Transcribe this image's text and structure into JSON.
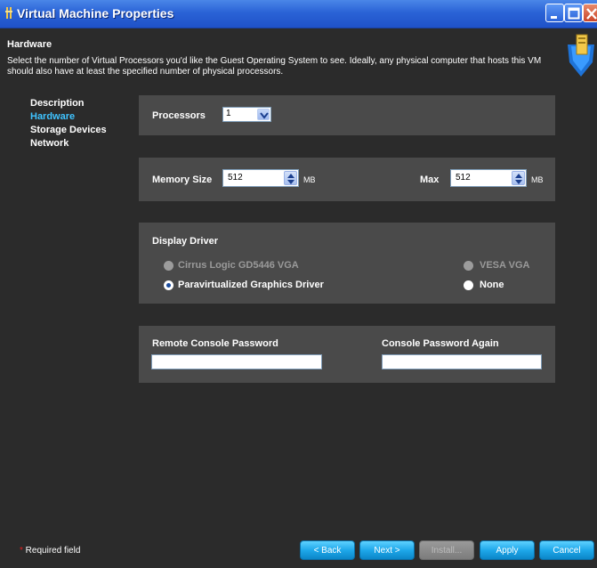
{
  "window": {
    "title": "Virtual Machine Properties"
  },
  "header": {
    "title": "Hardware",
    "description": "Select the number of Virtual Processors you'd like the Guest Operating System to see. Ideally, any physical computer that hosts this VM should also have at least the specified number of physical processors."
  },
  "nav": {
    "items": [
      {
        "label": "Description",
        "active": false
      },
      {
        "label": "Hardware",
        "active": true
      },
      {
        "label": "Storage Devices",
        "active": false
      },
      {
        "label": "Network",
        "active": false
      }
    ]
  },
  "processors": {
    "label": "Processors",
    "value": "1"
  },
  "memory": {
    "size_label": "Memory Size",
    "size_value": "512",
    "size_unit": "MB",
    "max_label": "Max",
    "max_value": "512",
    "max_unit": "MB"
  },
  "display": {
    "label": "Display Driver",
    "options": [
      {
        "label": "Cirrus Logic GD5446 VGA",
        "selected": false,
        "enabled": false
      },
      {
        "label": "VESA VGA",
        "selected": false,
        "enabled": false
      },
      {
        "label": "Paravirtualized Graphics Driver",
        "selected": true,
        "enabled": true
      },
      {
        "label": "None",
        "selected": false,
        "enabled": true
      }
    ]
  },
  "console": {
    "password_label": "Remote Console Password",
    "password_value": "",
    "again_label": "Console Password Again",
    "again_value": ""
  },
  "footer": {
    "required_star": "*",
    "required_text": " Required field",
    "back": "< Back",
    "next": "Next >",
    "install": "Install...",
    "apply": "Apply",
    "cancel": "Cancel"
  },
  "colors": {
    "background": "#2b2b2b",
    "panel": "#4a4a4a",
    "active_nav": "#3fc3ff",
    "button": "#1ea8ea",
    "titlebar": "#2a63d6"
  }
}
